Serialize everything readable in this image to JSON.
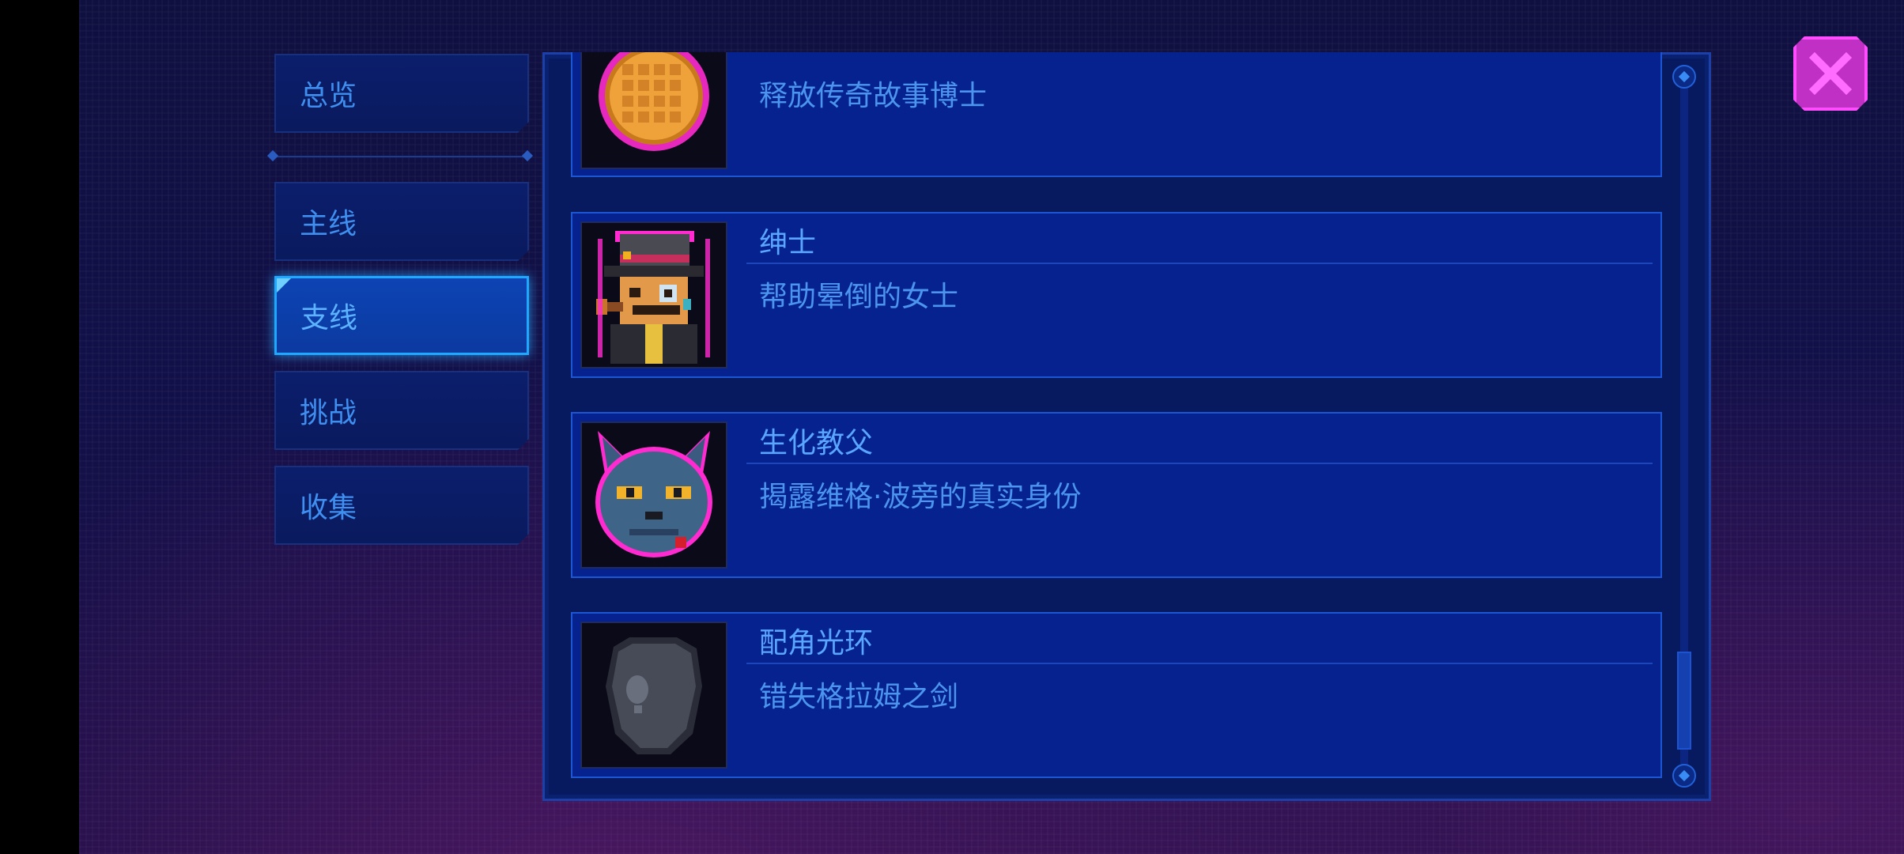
{
  "sidebar": {
    "items": [
      {
        "label": "总览",
        "active": false
      },
      {
        "label": "主线",
        "active": false
      },
      {
        "label": "支线",
        "active": true
      },
      {
        "label": "挑战",
        "active": false
      },
      {
        "label": "收集",
        "active": false
      }
    ]
  },
  "achievements": [
    {
      "title": "",
      "description": "释放传奇故事博士",
      "icon": "golden-orb-icon"
    },
    {
      "title": "绅士",
      "description": "帮助晕倒的女士",
      "icon": "gentleman-portrait-icon"
    },
    {
      "title": "生化教父",
      "description": "揭露维格·波旁的真实身份",
      "icon": "blue-cat-boss-icon"
    },
    {
      "title": "配角光环",
      "description": "错失格拉姆之剑",
      "icon": "locked-egg-icon"
    }
  ],
  "colors": {
    "accent": "#1fa8ff",
    "text_blue": "#5aa6ff",
    "close_magenta": "#ff4cff"
  }
}
